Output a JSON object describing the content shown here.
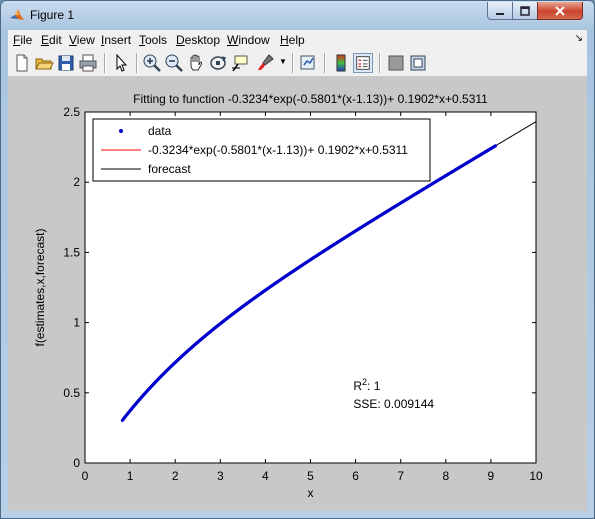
{
  "window": {
    "title": "Figure 1",
    "controls": [
      "minimize",
      "maximize",
      "close"
    ]
  },
  "menu": [
    {
      "label": "File",
      "accel": "F",
      "rest": "ile"
    },
    {
      "label": "Edit",
      "accel": "E",
      "rest": "dit"
    },
    {
      "label": "View",
      "accel": "V",
      "rest": "iew"
    },
    {
      "label": "Insert",
      "accel": "I",
      "rest": "nsert"
    },
    {
      "label": "Tools",
      "accel": "T",
      "rest": "ools"
    },
    {
      "label": "Desktop",
      "accel": "D",
      "rest": "esktop"
    },
    {
      "label": "Window",
      "accel": "W",
      "rest": "indow"
    },
    {
      "label": "Help",
      "accel": "H",
      "rest": "elp"
    }
  ],
  "toolbar": [
    "new-figure-icon",
    "open-file-icon",
    "save-icon",
    "print-icon",
    "edit-plot-arrow-icon",
    "zoom-in-icon",
    "zoom-out-icon",
    "pan-hand-icon",
    "rotate-3d-icon",
    "data-cursor-icon",
    "brush-icon",
    "colorbar-icon",
    "legend-icon",
    "hide-plot-tools-icon",
    "show-plot-tools-icon"
  ],
  "chart_data": {
    "type": "scatter",
    "title": "Fitting to function -0.3234*exp(-0.5801*(x-1.13))+ 0.1902*x+0.5311",
    "xlabel": "x",
    "ylabel": "f(estimates,x,forecast)",
    "xlim": [
      0,
      10
    ],
    "ylim": [
      0,
      2.5
    ],
    "xticks": [
      "0",
      "1",
      "2",
      "3",
      "4",
      "5",
      "6",
      "7",
      "8",
      "9",
      "10"
    ],
    "yticks": [
      "0",
      "0.5",
      "1",
      "1.5",
      "2",
      "2.5"
    ],
    "function": {
      "a": -0.3234,
      "b": -0.5801,
      "c": 1.13,
      "d": 0.1902,
      "e": 0.5311
    },
    "series": [
      {
        "name": "data",
        "color": "#0000cc",
        "x_range": [
          0.83,
          9.1
        ],
        "n_points": 400,
        "marker": "dot"
      },
      {
        "name": "-0.3234*exp(-0.5801*(x-1.13))+ 0.1902*x+0.5311",
        "color": "#ff0000",
        "x_range": [
          0.83,
          9.1
        ],
        "marker": "line"
      },
      {
        "name": "forecast",
        "color": "#000000",
        "x_range": [
          0.83,
          10
        ],
        "marker": "line"
      }
    ],
    "legend": {
      "placement": "top-left"
    },
    "annotation": {
      "r2_label": "R",
      "r2_sup": "2",
      "r2_value": ": 1",
      "sse": "SSE: 0.009144"
    }
  }
}
